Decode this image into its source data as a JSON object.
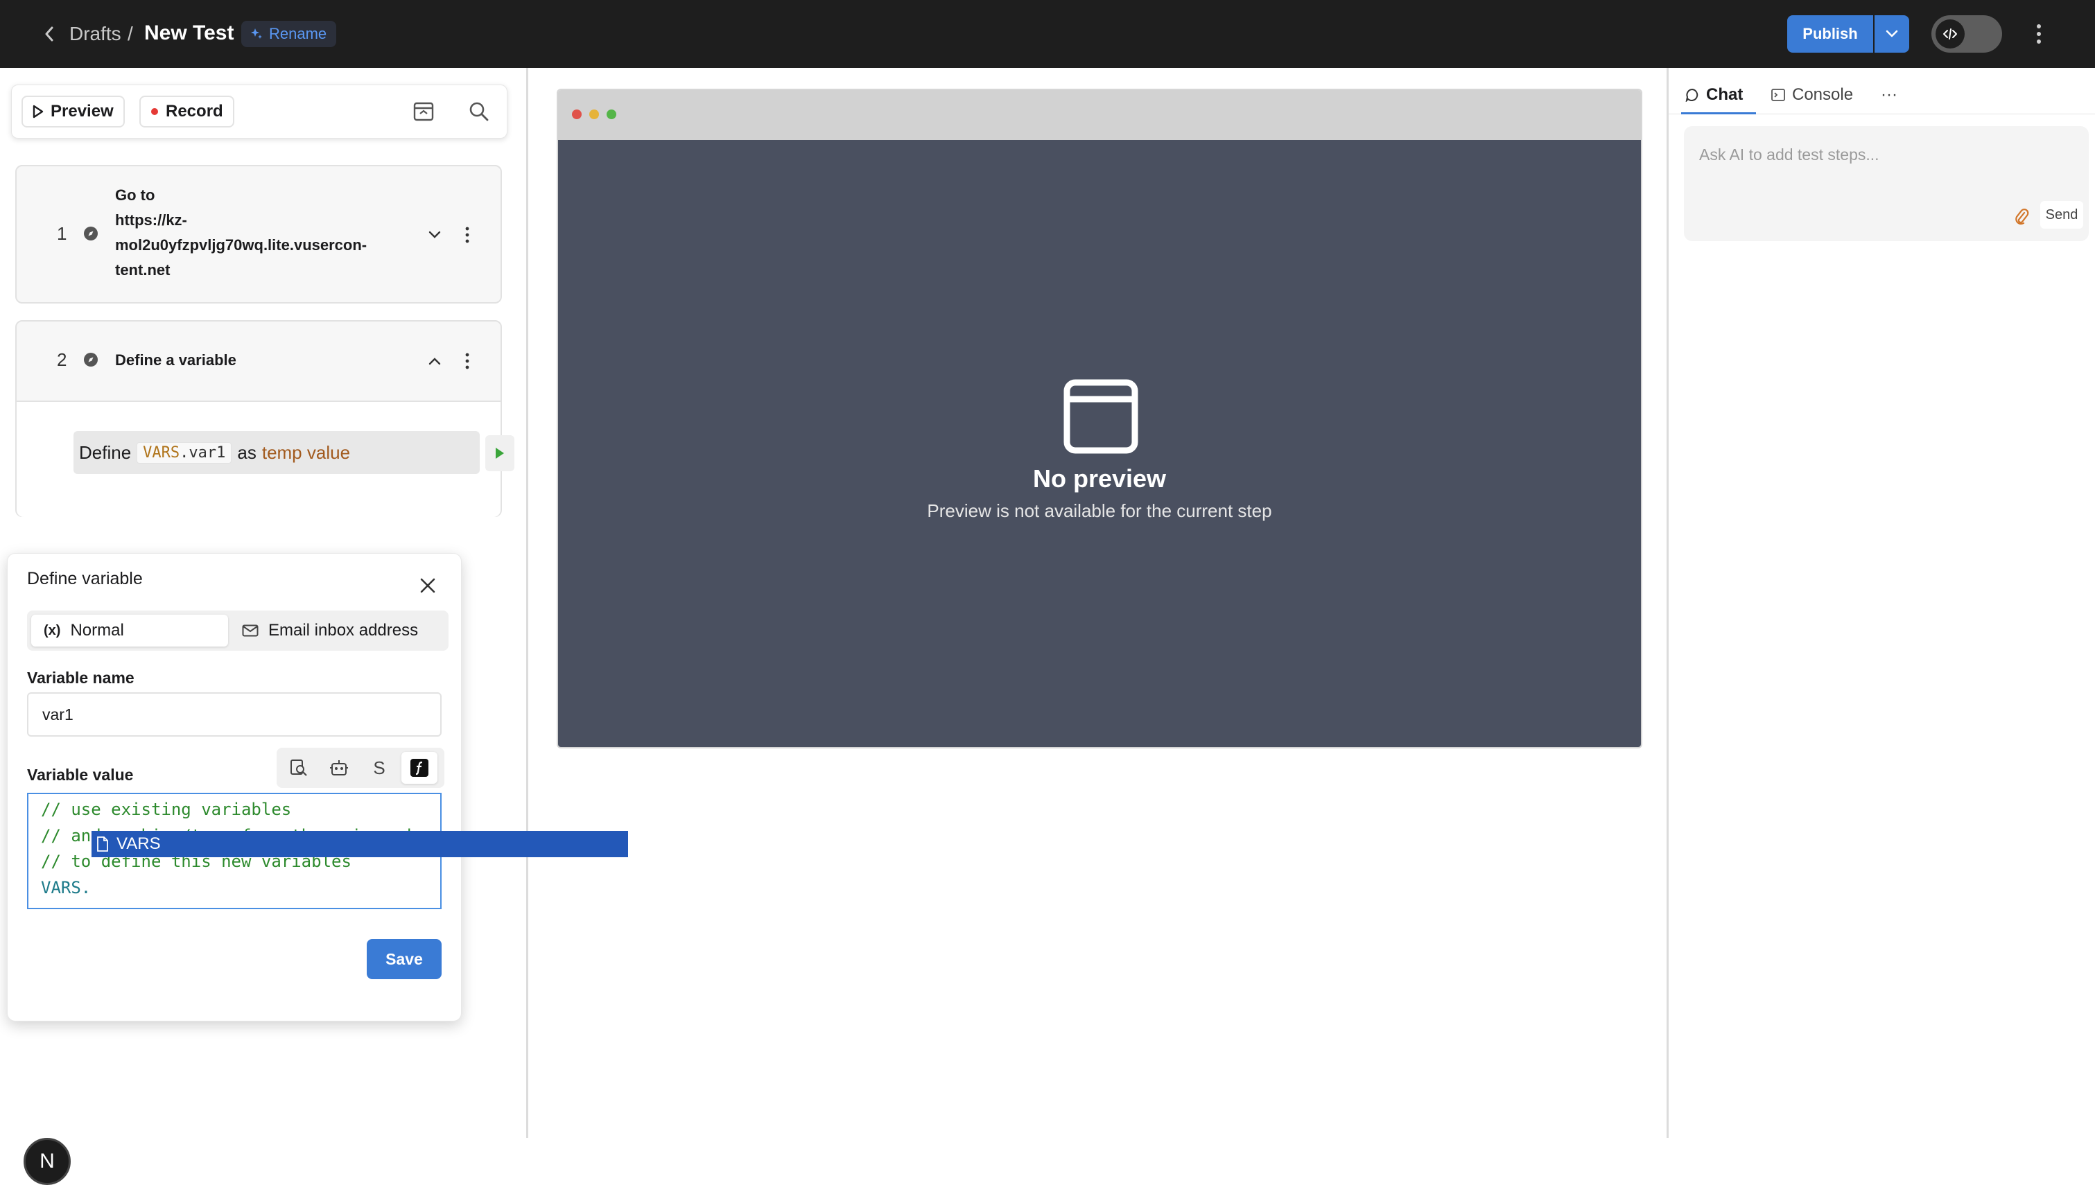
{
  "header": {
    "breadcrumb_parent": "Drafts",
    "separator": "/",
    "title": "New Test",
    "rename_label": "Rename",
    "publish_label": "Publish"
  },
  "toolbar": {
    "preview_label": "Preview",
    "record_label": "Record"
  },
  "steps": [
    {
      "number": "1",
      "lines": [
        "Go to",
        "https://kz-",
        "mol2u0yfzpvljg70wq.lite.vusercon-",
        "tent.net"
      ]
    },
    {
      "number": "2",
      "label": "Define a variable",
      "define_prefix": "Define",
      "var_ns": "VARS",
      "var_dot_name": ".var1",
      "define_as": "as",
      "define_value": "temp value"
    }
  ],
  "dialog": {
    "title": "Define variable",
    "mode_normal_icon": "(x)",
    "mode_normal": "Normal",
    "mode_email": "Email inbox address",
    "name_label": "Variable name",
    "name_value": "var1",
    "value_label": "Variable value",
    "value_mode_s": "S",
    "code_lines": [
      "// use existing variables",
      "// and combine/transform them via code",
      "// to define this new variables",
      "VARS."
    ],
    "save_label": "Save"
  },
  "autocomplete": {
    "items": [
      "VARS"
    ]
  },
  "preview": {
    "title": "No preview",
    "subtitle": "Preview is not available for the current step"
  },
  "right": {
    "tab_chat": "Chat",
    "tab_console": "Console",
    "tab_more": "···",
    "chat_placeholder": "Ask AI to add test steps...",
    "send_label": "Send"
  },
  "avatar": {
    "initial": "N"
  },
  "colors": {
    "accent": "#3a7bd5",
    "topbar": "#1e1e1e",
    "preview_bg": "#4a5060",
    "record_dot": "#e53935",
    "run_green": "#3aa53a"
  }
}
